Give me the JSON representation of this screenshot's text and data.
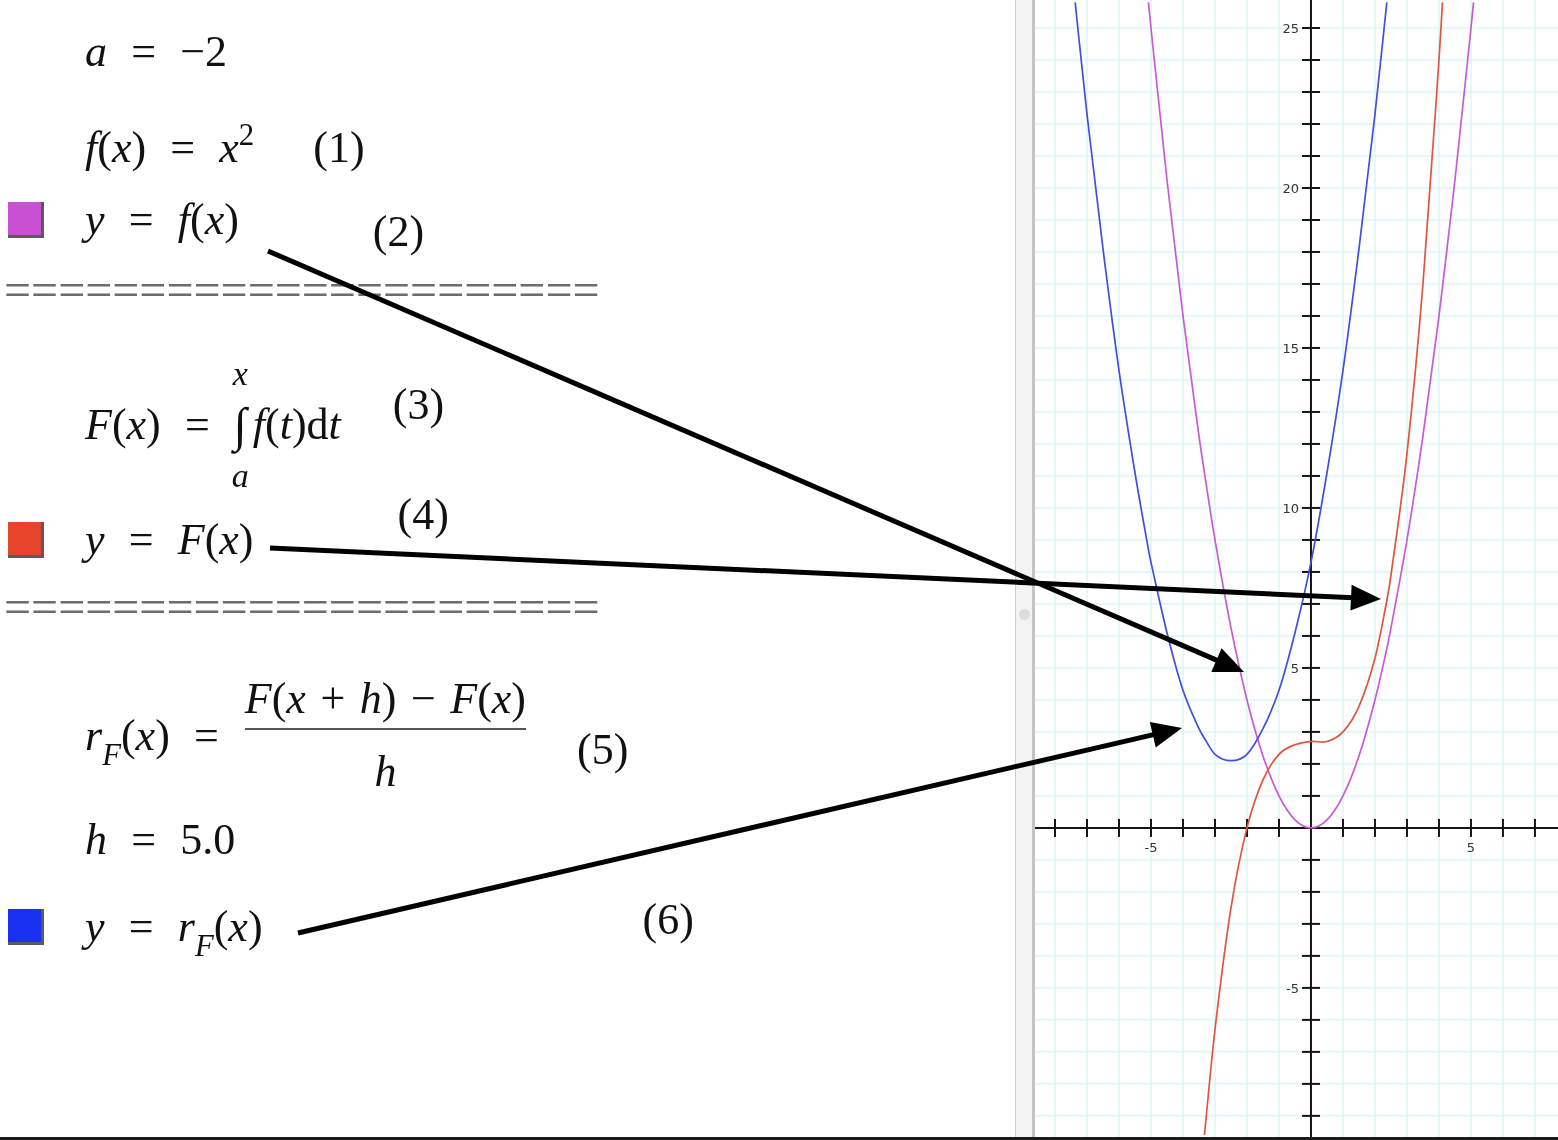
{
  "worksheet": [
    {
      "kind": "math",
      "text": "*a* = −2"
    },
    {
      "kind": "math",
      "text": "*f*(*x*) = *x*$^{2}$",
      "label": "(1)"
    },
    {
      "kind": "plot",
      "color": "#c94fd4",
      "text": "*y* = *f*(*x*)",
      "label": "(2)"
    },
    {
      "kind": "separator",
      "text": "======================"
    },
    {
      "kind": "integral",
      "lhs": "*F*(*x*) =",
      "upper": "x",
      "sign": "∫",
      "lower": "a",
      "integrand": "*f*(*t*)",
      "differential": "dt",
      "label": "(3)"
    },
    {
      "kind": "plot",
      "color": "#e8442b",
      "text": "*y* = *F*(*x*)",
      "label": "(4)"
    },
    {
      "kind": "separator",
      "text": "======================"
    },
    {
      "kind": "fraction",
      "lhs": "*r*$_{F}$(*x*) =",
      "numerator": "*F*(*x* + *h*) − *F*(*x*)",
      "denominator": "h",
      "label": "(5)"
    },
    {
      "kind": "math",
      "text": "*h* = 5.0"
    },
    {
      "kind": "plot",
      "color": "#1a30f0",
      "text": "*y* = *r*$_{F}$(*x*)",
      "label": "(6)"
    }
  ],
  "graph": {
    "chart_data": {
      "type": "line",
      "x": [
        -7.37,
        -7,
        -6.5,
        -6,
        -5.5,
        -5.08,
        -5,
        -4.5,
        -4,
        -3.5,
        -3.33,
        -3,
        -2.5,
        -2,
        -1.5,
        -1,
        -0.5,
        0,
        0.5,
        1,
        1.5,
        2,
        2.37,
        2.5,
        3,
        3.5,
        4,
        4.11,
        4.5,
        5,
        5.08
      ],
      "series": [
        {
          "color": "#c85ad8",
          "values": [
            null,
            null,
            null,
            null,
            null,
            25.8,
            25,
            20.25,
            16,
            12.25,
            11.1,
            9,
            6.25,
            4,
            2.25,
            1,
            0.25,
            0,
            0.25,
            1,
            2.25,
            4,
            5.6,
            6.25,
            9,
            12.25,
            16,
            16.9,
            20.25,
            25,
            25.8
          ]
        },
        {
          "color": "#e0553f",
          "values": [
            null,
            null,
            null,
            null,
            null,
            null,
            null,
            null,
            null,
            null,
            -9.6,
            -6.3,
            -2.5,
            0,
            1.5,
            2.3,
            2.6,
            2.7,
            2.7,
            3,
            3.8,
            5.3,
            7.1,
            7.9,
            11.7,
            17,
            24,
            25.8,
            null,
            null,
            null
          ]
        },
        {
          "color": "#3f4fe0",
          "values": [
            25.8,
            22.3,
            18.1,
            14.3,
            11.1,
            8.7,
            8.3,
            6.1,
            4.3,
            3.1,
            2.8,
            2.3,
            2.1,
            2.3,
            3.1,
            4.3,
            6.1,
            8.3,
            11.1,
            14.3,
            18.1,
            22.3,
            25.8,
            null,
            null,
            null,
            null,
            null,
            null,
            null,
            null
          ]
        }
      ],
      "xlim": [
        -8.625,
        7.72
      ],
      "ylim": [
        -9.66,
        25.875
      ],
      "xticks": [
        -5,
        5
      ],
      "yticks": [
        -5,
        5,
        10,
        15,
        20,
        25
      ],
      "grid": true
    }
  }
}
